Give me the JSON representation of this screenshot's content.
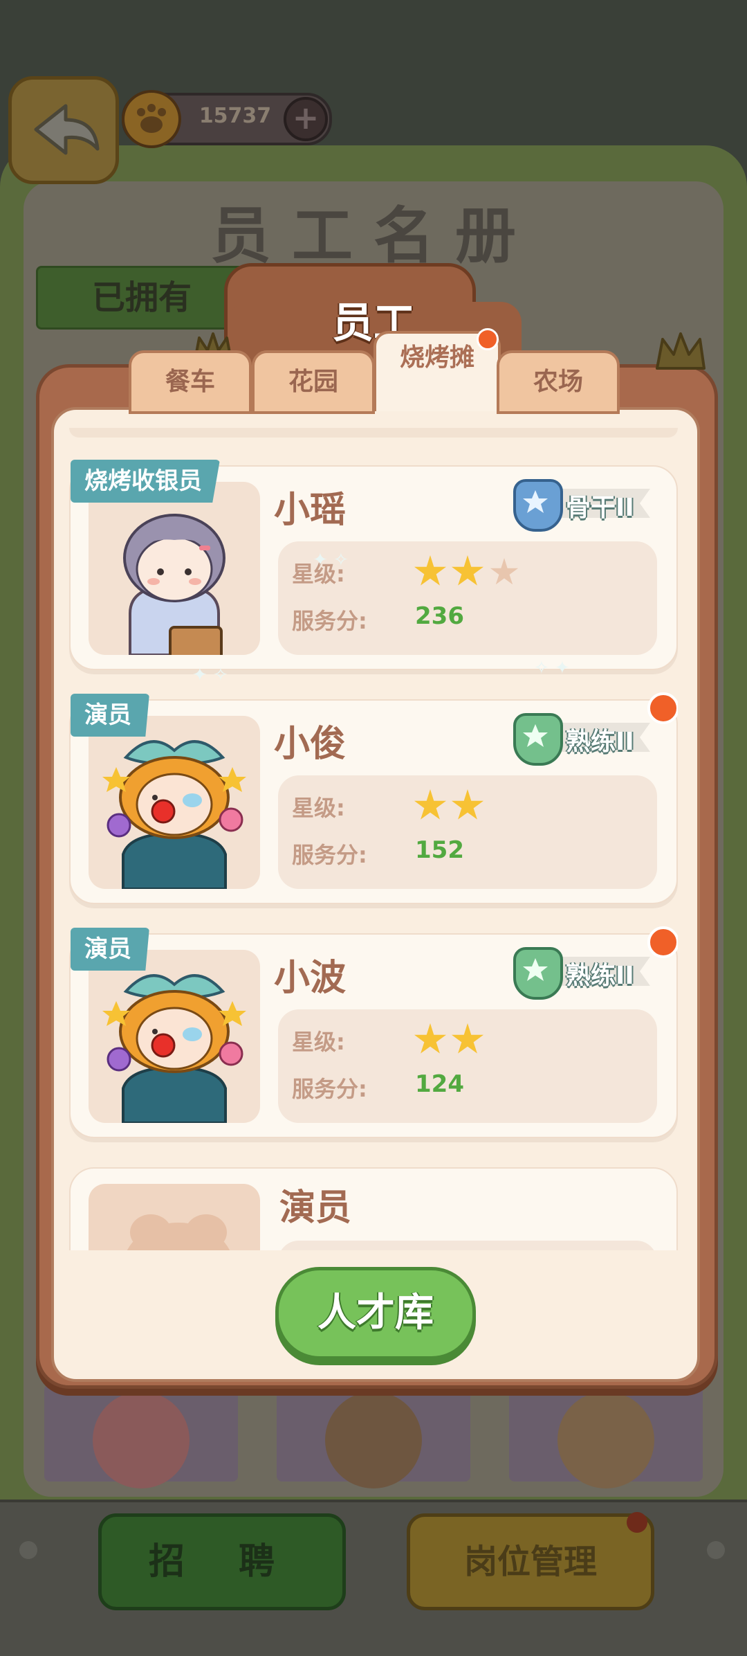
{
  "hud": {
    "coins": "15737",
    "plus": "+"
  },
  "background": {
    "title": "员工名册",
    "owned_tag": "已拥有",
    "recruit_label": "招 聘",
    "position_label": "岗位管理"
  },
  "dialog": {
    "title": "员工",
    "tabs": [
      {
        "label": "餐车",
        "active": false
      },
      {
        "label": "花园",
        "active": false
      },
      {
        "label": "烧烤摊",
        "active": true
      },
      {
        "label": "农场",
        "active": false
      }
    ],
    "stat_labels": {
      "stars": "星级:",
      "score": "服务分:"
    },
    "staff": [
      {
        "role": "烧烤收银员",
        "name": "小瑶",
        "rank": "骨干II",
        "stars": 2,
        "max_stars": 3,
        "score": "236",
        "has_notice": false
      },
      {
        "role": "演员",
        "name": "小俊",
        "rank": "熟练II",
        "stars": 2,
        "max_stars": 2,
        "score": "152",
        "has_notice": true
      },
      {
        "role": "演员",
        "name": "小波",
        "rank": "熟练II",
        "stars": 2,
        "max_stars": 2,
        "score": "124",
        "has_notice": true
      },
      {
        "role": "",
        "name": "演员",
        "locked": true
      }
    ],
    "talent_button": "人才库"
  },
  "colors": {
    "tab_active": "#fbf1e4",
    "dialog_frame": "#a8694c",
    "score_green": "#52a940",
    "star_gold": "#f7c234",
    "notice_red": "#f06028",
    "role_tag": "#5aa6ae"
  }
}
